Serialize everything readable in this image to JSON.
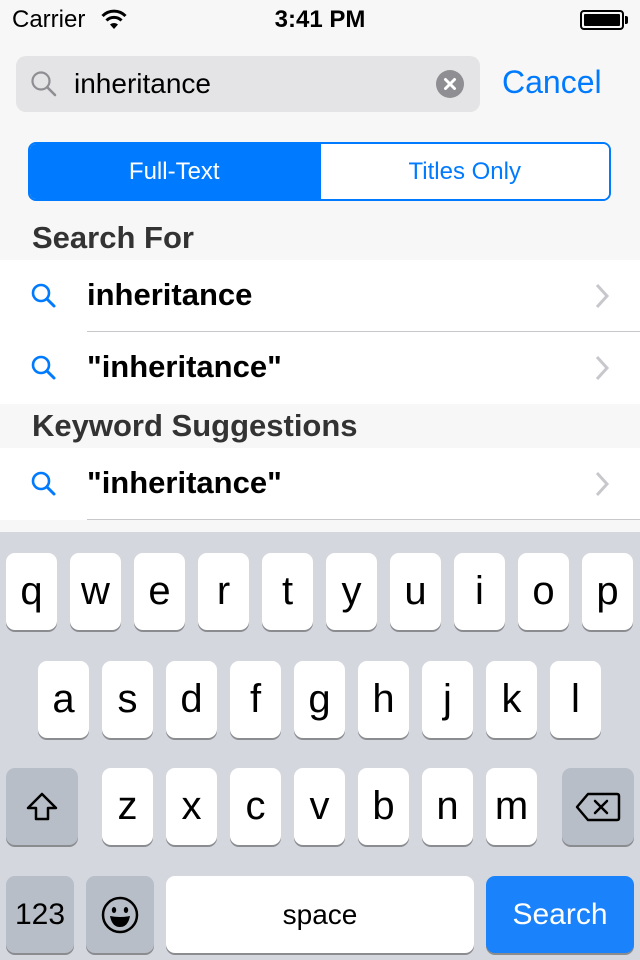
{
  "status_bar": {
    "carrier": "Carrier",
    "time": "3:41 PM",
    "wifi_icon": "wifi-icon",
    "battery_icon": "battery-full-icon"
  },
  "search": {
    "value": "inheritance",
    "search_icon": "magnifying-glass-icon",
    "clear_icon": "clear-circle-x-icon",
    "cancel_label": "Cancel"
  },
  "scope": {
    "segments": [
      "Full-Text",
      "Titles Only"
    ],
    "selected": "Full-Text"
  },
  "sections": [
    {
      "header": "Search For",
      "rows": [
        {
          "text": "inheritance"
        },
        {
          "text": "\"inheritance\""
        }
      ]
    },
    {
      "header": "Keyword Suggestions",
      "rows": [
        {
          "text": "\"inheritance\""
        }
      ]
    }
  ],
  "keyboard": {
    "row1": [
      "q",
      "w",
      "e",
      "r",
      "t",
      "y",
      "u",
      "i",
      "o",
      "p"
    ],
    "row2": [
      "a",
      "s",
      "d",
      "f",
      "g",
      "h",
      "j",
      "k",
      "l"
    ],
    "row3": [
      "z",
      "x",
      "c",
      "v",
      "b",
      "n",
      "m"
    ],
    "shift_icon": "shift-arrow-icon",
    "delete_icon": "backspace-icon",
    "numbers_label": "123",
    "emoji_icon": "emoji-smiley-icon",
    "space_label": "space",
    "return_label": "Search"
  },
  "colors": {
    "accent": "#007aff",
    "keyboard_bg": "#d4d8de",
    "search_field_bg": "#e4e4e6"
  }
}
